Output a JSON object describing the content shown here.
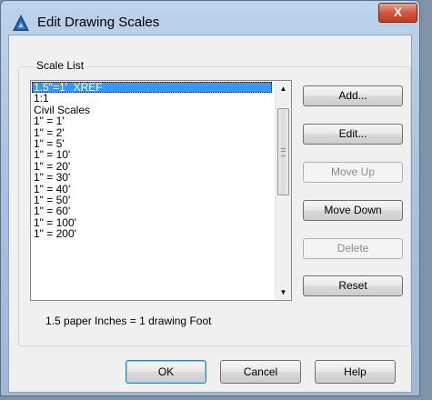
{
  "window": {
    "title": "Edit Drawing Scales",
    "close_glyph": "X"
  },
  "scale_list": {
    "group_label": "Scale List",
    "items": [
      "1.5\"=1'_XREF",
      "1:1",
      "Civil Scales",
      "1\" = 1'",
      "1\" = 2'",
      "1\" = 5'",
      "1\" = 10'",
      "1\" = 20'",
      "1\" = 30'",
      "1\" = 40'",
      "1\" = 50'",
      "1\" = 60'",
      "1\" = 100'",
      "1\" = 200'"
    ],
    "selected_index": 0,
    "scroll_up_glyph": "▲",
    "scroll_down_glyph": "▼"
  },
  "buttons": {
    "add": "Add...",
    "edit": "Edit...",
    "move_up": "Move Up",
    "move_down": "Move Down",
    "delete": "Delete",
    "reset": "Reset",
    "ok": "OK",
    "cancel": "Cancel",
    "help": "Help"
  },
  "hint": "1.5 paper Inches = 1 drawing Foot",
  "icons": {
    "app": "autocad-a-icon",
    "close": "close-icon"
  },
  "colors": {
    "selection": "#3399ff",
    "close_button": "#c13b22"
  }
}
